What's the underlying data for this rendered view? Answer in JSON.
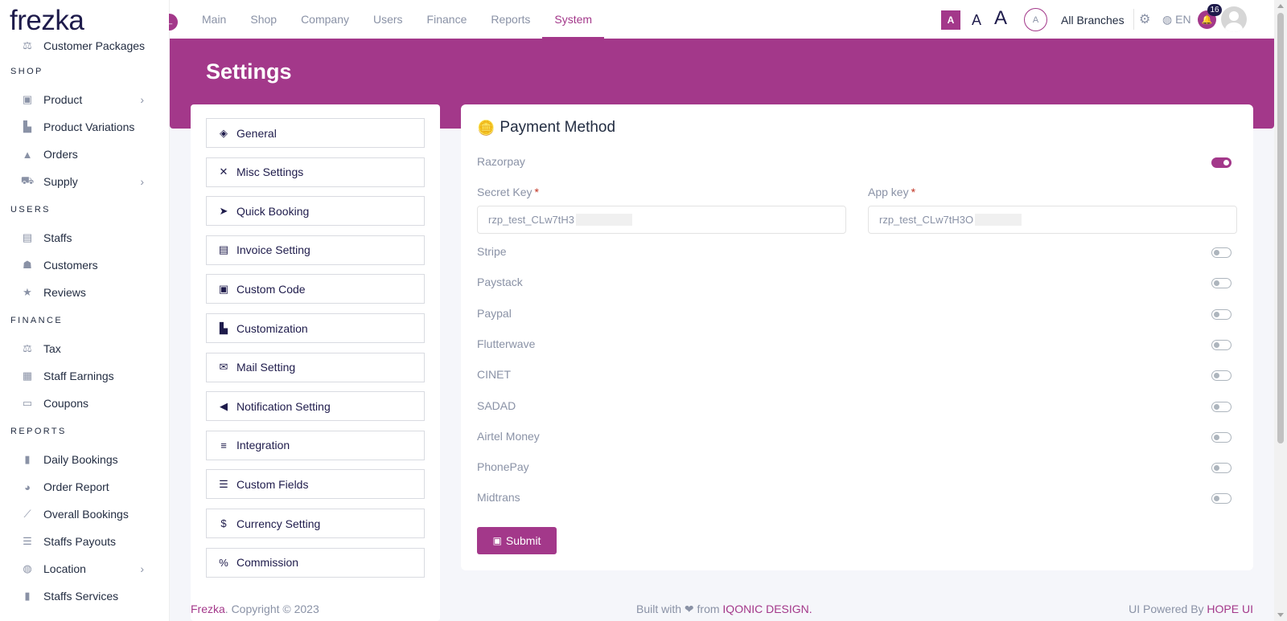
{
  "brand": {
    "logo": "frezka",
    "accent": "#a3388a",
    "navy": "#1e1b4b"
  },
  "sidebar": {
    "items": [
      {
        "type": "item",
        "label": "Customer Packages",
        "icon": "package-icon",
        "glyph": "⚖",
        "partial": true
      },
      {
        "type": "head",
        "label": "SHOP"
      },
      {
        "type": "item",
        "label": "Product",
        "icon": "product-icon",
        "glyph": "▣",
        "chevron": true
      },
      {
        "type": "item",
        "label": "Product Variations",
        "icon": "variations-icon",
        "glyph": "▙"
      },
      {
        "type": "item",
        "label": "Orders",
        "icon": "orders-icon",
        "glyph": "▲"
      },
      {
        "type": "item",
        "label": "Supply",
        "icon": "truck-icon",
        "glyph": "⛟",
        "chevron": true
      },
      {
        "type": "head",
        "label": "USERS"
      },
      {
        "type": "item",
        "label": "Staffs",
        "icon": "id-card-icon",
        "glyph": "▤"
      },
      {
        "type": "item",
        "label": "Customers",
        "icon": "users-icon",
        "glyph": "☗"
      },
      {
        "type": "item",
        "label": "Reviews",
        "icon": "star-icon",
        "glyph": "★"
      },
      {
        "type": "head",
        "label": "FINANCE"
      },
      {
        "type": "item",
        "label": "Tax",
        "icon": "tax-icon",
        "glyph": "⚖"
      },
      {
        "type": "item",
        "label": "Staff Earnings",
        "icon": "money-icon",
        "glyph": "▦"
      },
      {
        "type": "item",
        "label": "Coupons",
        "icon": "coupon-icon",
        "glyph": "▭"
      },
      {
        "type": "head",
        "label": "REPORTS"
      },
      {
        "type": "item",
        "label": "Daily Bookings",
        "icon": "file-icon",
        "glyph": "▮"
      },
      {
        "type": "item",
        "label": "Order Report",
        "icon": "pie-chart-icon",
        "glyph": "◕"
      },
      {
        "type": "item",
        "label": "Overall Bookings",
        "icon": "line-chart-icon",
        "glyph": "⟋"
      },
      {
        "type": "item",
        "label": "Staffs Payouts",
        "icon": "list-icon",
        "glyph": "☰"
      },
      {
        "type": "item",
        "label": "Location",
        "icon": "globe-icon",
        "glyph": "◍",
        "chevron": true
      },
      {
        "type": "item",
        "label": "Staffs Services",
        "icon": "clipboard-icon",
        "glyph": "▮"
      }
    ]
  },
  "topbar": {
    "nav": [
      "Main",
      "Shop",
      "Company",
      "Users",
      "Finance",
      "Reports",
      "System"
    ],
    "active": "System",
    "font_small": "A",
    "font_medium": "A",
    "font_large": "A",
    "branch_avatar": "A",
    "branch": "All Branches",
    "lang": "EN",
    "notifications": "16"
  },
  "page": {
    "title": "Settings"
  },
  "settings_menu": [
    {
      "label": "General",
      "icon": "cube-icon",
      "glyph": "◈"
    },
    {
      "label": "Misc Settings",
      "icon": "tools-icon",
      "glyph": "✕"
    },
    {
      "label": "Quick Booking",
      "icon": "paper-plane-icon",
      "glyph": "➤"
    },
    {
      "label": "Invoice Setting",
      "icon": "invoice-icon",
      "glyph": "▤"
    },
    {
      "label": "Custom Code",
      "icon": "code-file-icon",
      "glyph": "▣"
    },
    {
      "label": "Customization",
      "icon": "customization-icon",
      "glyph": "▙"
    },
    {
      "label": "Mail Setting",
      "icon": "envelope-icon",
      "glyph": "✉"
    },
    {
      "label": "Notification Setting",
      "icon": "megaphone-icon",
      "glyph": "◀"
    },
    {
      "label": "Integration",
      "icon": "sliders-icon",
      "glyph": "≡"
    },
    {
      "label": "Custom Fields",
      "icon": "bars-icon",
      "glyph": "☰"
    },
    {
      "label": "Currency Setting",
      "icon": "dollar-icon",
      "glyph": "$"
    },
    {
      "label": "Commission",
      "icon": "percent-icon",
      "glyph": "%"
    }
  ],
  "payment": {
    "title": "Payment Method",
    "methods": [
      {
        "name": "Razorpay",
        "enabled": true
      },
      {
        "name": "Stripe",
        "enabled": false
      },
      {
        "name": "Paystack",
        "enabled": false
      },
      {
        "name": "Paypal",
        "enabled": false
      },
      {
        "name": "Flutterwave",
        "enabled": false
      },
      {
        "name": "CINET",
        "enabled": false
      },
      {
        "name": "SADAD",
        "enabled": false
      },
      {
        "name": "Airtel Money",
        "enabled": false
      },
      {
        "name": "PhonePay",
        "enabled": false
      },
      {
        "name": "Midtrans",
        "enabled": false
      }
    ],
    "secret_key_label": "Secret Key",
    "secret_key_value": "rzp_test_CLw7tH3",
    "app_key_label": "App key",
    "app_key_value": "rzp_test_CLw7tH3O",
    "required_mark": "*",
    "submit_label": "Submit"
  },
  "footer": {
    "brand": "Frezka",
    "copyright": ". Copyright © 2023",
    "built_prefix": "Built with ❤ from ",
    "built_by": "IQONIC DESIGN.",
    "powered_prefix": "UI Powered By ",
    "powered_by": "HOPE UI"
  }
}
